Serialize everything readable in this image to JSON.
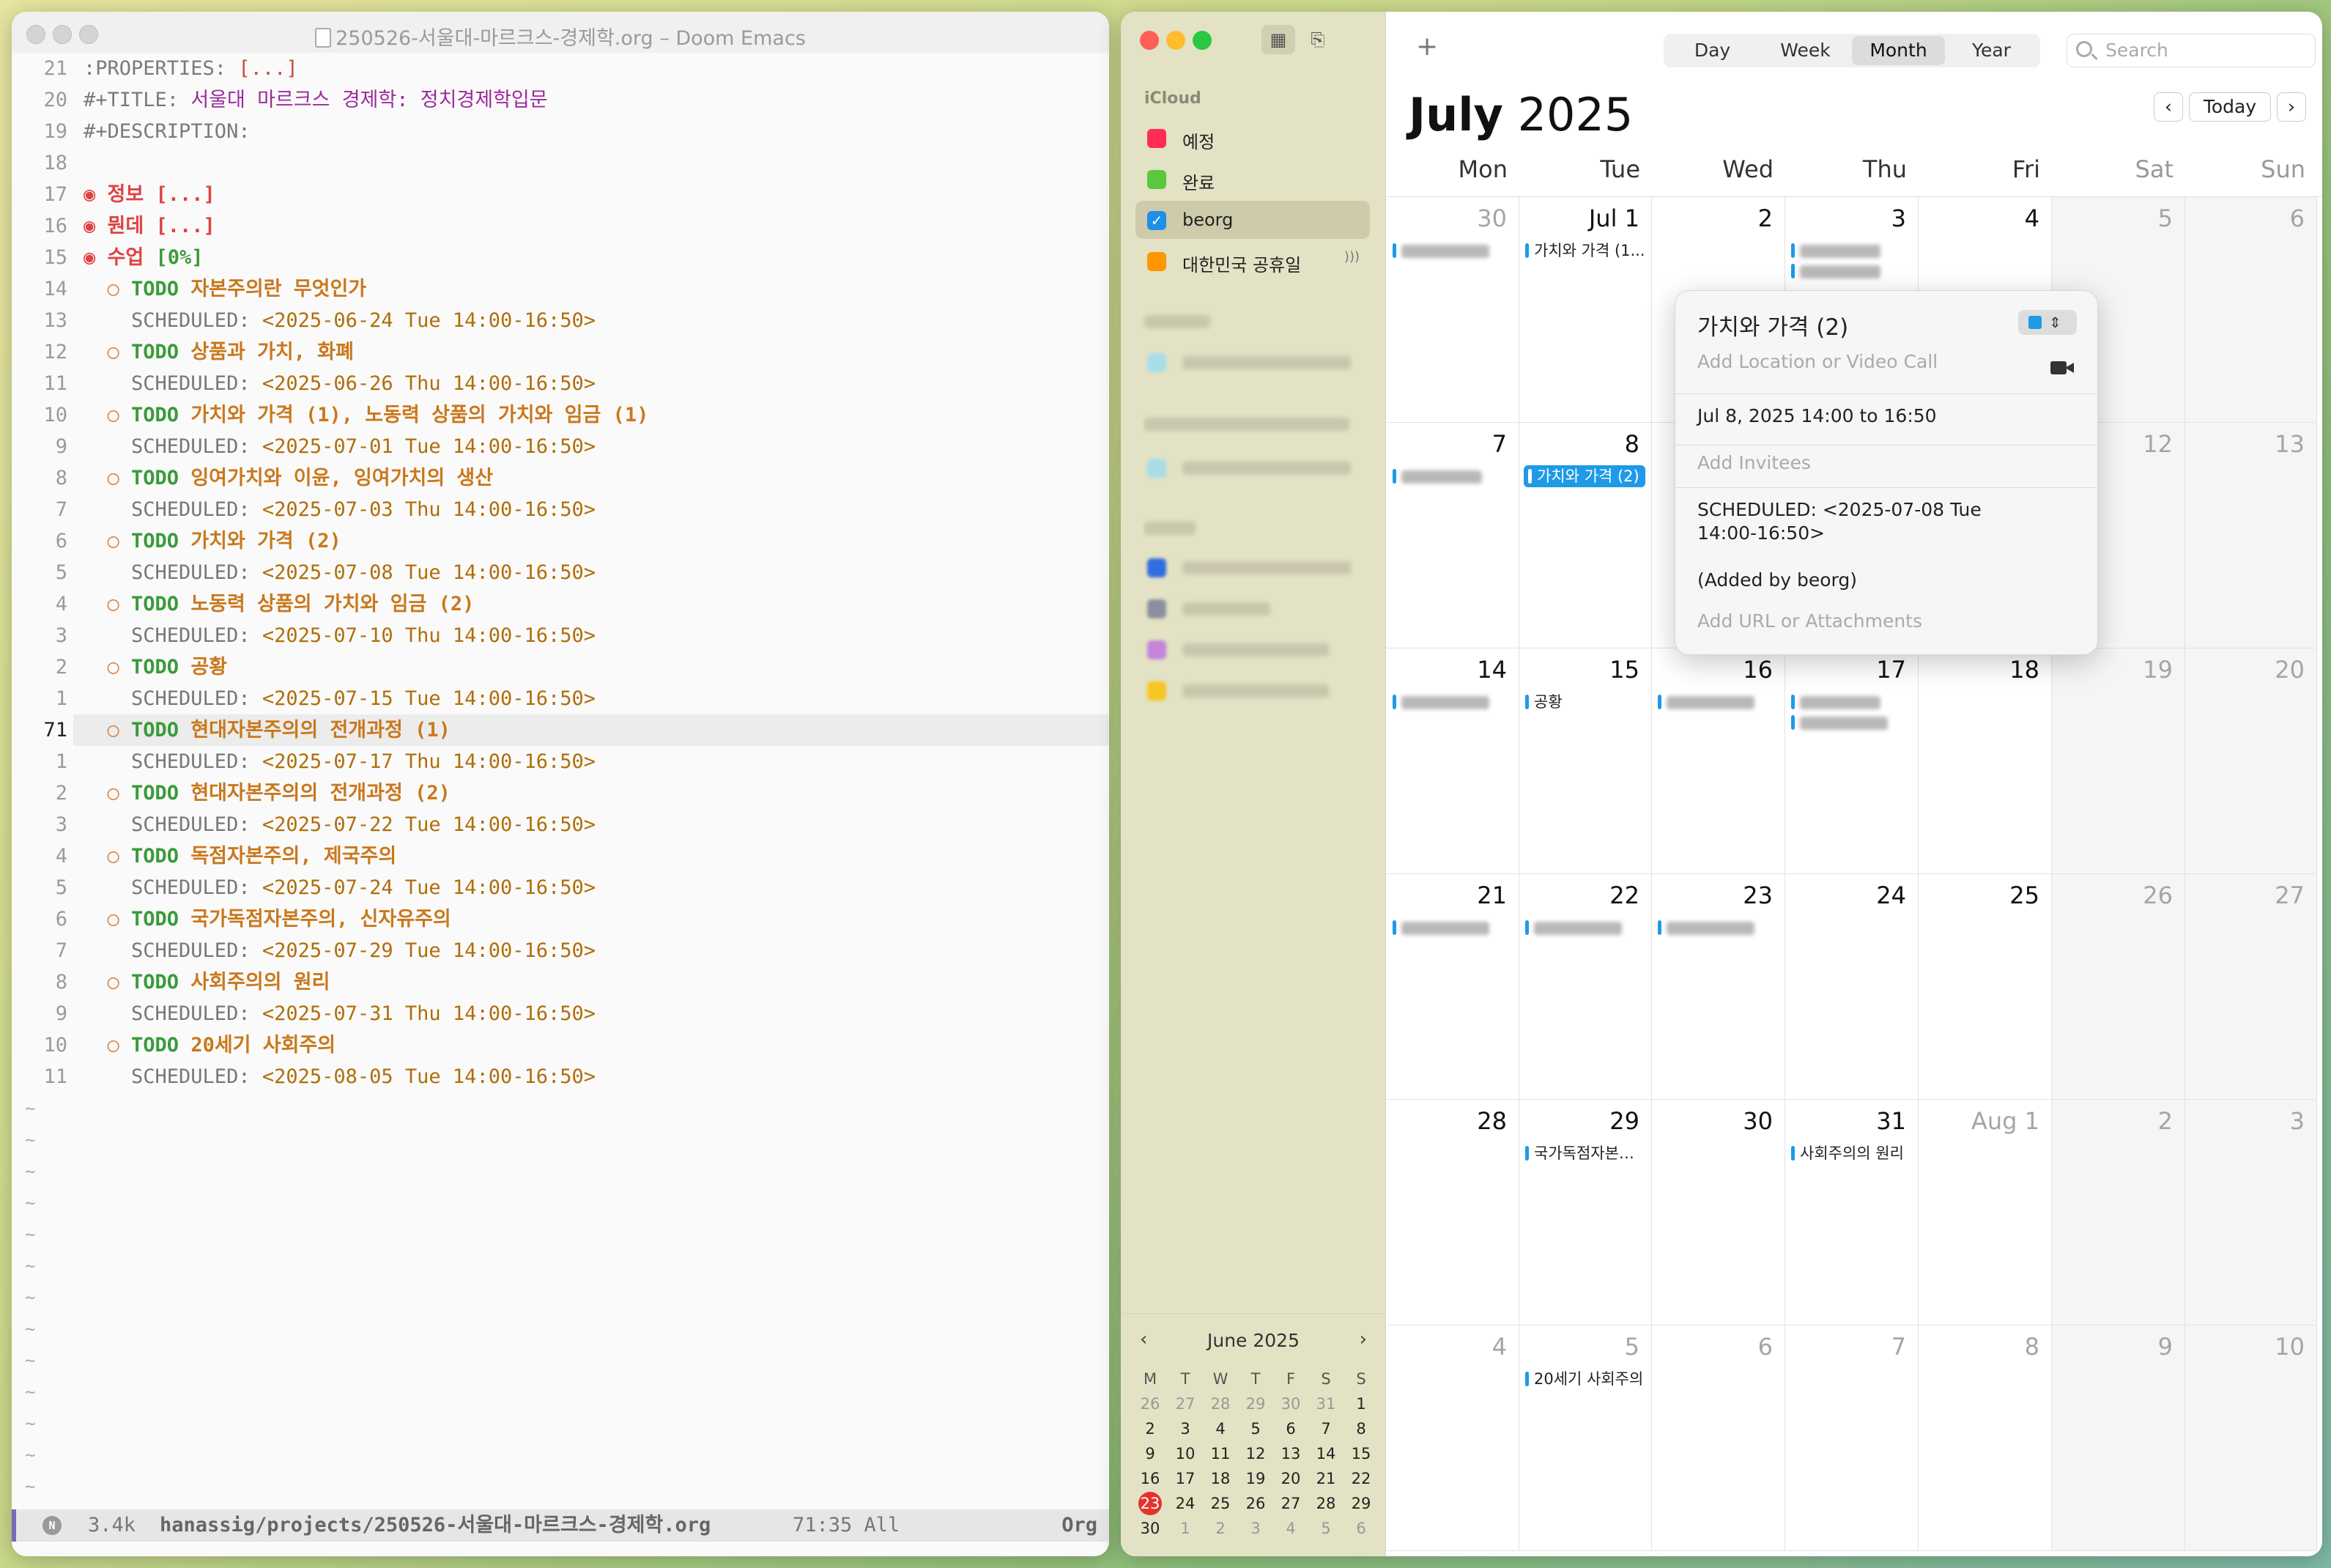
{
  "emacs": {
    "title": "250526-서울대-마르크스-경제학.org – Doom Emacs",
    "lines": [
      {
        "ln": "21",
        "type": "meta",
        "parts": [
          ":PROPERTIES: ",
          "[...]"
        ]
      },
      {
        "ln": "20",
        "type": "title",
        "parts": [
          "#+TITLE: ",
          "서울대 마르크스 경제학: 정치경제학입문"
        ]
      },
      {
        "ln": "19",
        "type": "meta",
        "parts": [
          "#+DESCRIPTION:"
        ]
      },
      {
        "ln": "18",
        "type": "blank",
        "parts": []
      },
      {
        "ln": "17",
        "type": "h1",
        "parts": [
          "◉ ",
          "정보 [...]"
        ]
      },
      {
        "ln": "16",
        "type": "h1",
        "parts": [
          "◉ ",
          "뭔데 [...]"
        ]
      },
      {
        "ln": "15",
        "type": "h1pct",
        "parts": [
          "◉ ",
          "수업 ",
          "[0%]"
        ]
      },
      {
        "ln": "14",
        "type": "todo",
        "parts": [
          "  ○ ",
          "TODO ",
          "자본주의란 무엇인가"
        ]
      },
      {
        "ln": "13",
        "type": "sched",
        "parts": [
          "    SCHEDULED: ",
          "<2025-06-24 Tue 14:00-16:50>"
        ]
      },
      {
        "ln": "12",
        "type": "todo",
        "parts": [
          "  ○ ",
          "TODO ",
          "상품과 가치, 화폐"
        ]
      },
      {
        "ln": "11",
        "type": "sched",
        "parts": [
          "    SCHEDULED: ",
          "<2025-06-26 Thu 14:00-16:50>"
        ]
      },
      {
        "ln": "10",
        "type": "todo",
        "parts": [
          "  ○ ",
          "TODO ",
          "가치와 가격 (1), 노동력 상품의 가치와 임금 (1)"
        ]
      },
      {
        "ln": "9",
        "type": "sched",
        "parts": [
          "    SCHEDULED: ",
          "<2025-07-01 Tue 14:00-16:50>"
        ]
      },
      {
        "ln": "8",
        "type": "todo",
        "parts": [
          "  ○ ",
          "TODO ",
          "잉여가치와 이윤, 잉여가치의 생산"
        ]
      },
      {
        "ln": "7",
        "type": "sched",
        "parts": [
          "    SCHEDULED: ",
          "<2025-07-03 Thu 14:00-16:50>"
        ]
      },
      {
        "ln": "6",
        "type": "todo",
        "parts": [
          "  ○ ",
          "TODO ",
          "가치와 가격 (2)"
        ]
      },
      {
        "ln": "5",
        "type": "sched",
        "parts": [
          "    SCHEDULED: ",
          "<2025-07-08 Tue 14:00-16:50>"
        ]
      },
      {
        "ln": "4",
        "type": "todo",
        "parts": [
          "  ○ ",
          "TODO ",
          "노동력 상품의 가치와 임금 (2)"
        ]
      },
      {
        "ln": "3",
        "type": "sched",
        "parts": [
          "    SCHEDULED: ",
          "<2025-07-10 Thu 14:00-16:50>"
        ]
      },
      {
        "ln": "2",
        "type": "todo",
        "parts": [
          "  ○ ",
          "TODO ",
          "공황"
        ]
      },
      {
        "ln": "1",
        "type": "sched",
        "parts": [
          "    SCHEDULED: ",
          "<2025-07-15 Tue 14:00-16:50>"
        ]
      },
      {
        "ln": "71",
        "type": "todo",
        "current": true,
        "parts": [
          "  ○ ",
          "TODO ",
          "현대자본주의의 전개과정 (1)"
        ]
      },
      {
        "ln": "1",
        "type": "sched",
        "parts": [
          "    SCHEDULED: ",
          "<2025-07-17 Thu 14:00-16:50>"
        ]
      },
      {
        "ln": "2",
        "type": "todo",
        "parts": [
          "  ○ ",
          "TODO ",
          "현대자본주의의 전개과정 (2)"
        ]
      },
      {
        "ln": "3",
        "type": "sched",
        "parts": [
          "    SCHEDULED: ",
          "<2025-07-22 Tue 14:00-16:50>"
        ]
      },
      {
        "ln": "4",
        "type": "todo",
        "parts": [
          "  ○ ",
          "TODO ",
          "독점자본주의, 제국주의"
        ]
      },
      {
        "ln": "5",
        "type": "sched",
        "parts": [
          "    SCHEDULED: ",
          "<2025-07-24 Tue 14:00-16:50>"
        ]
      },
      {
        "ln": "6",
        "type": "todo",
        "parts": [
          "  ○ ",
          "TODO ",
          "국가독점자본주의, 신자유주의"
        ]
      },
      {
        "ln": "7",
        "type": "sched",
        "parts": [
          "    SCHEDULED: ",
          "<2025-07-29 Tue 14:00-16:50>"
        ]
      },
      {
        "ln": "8",
        "type": "todo",
        "parts": [
          "  ○ ",
          "TODO ",
          "사회주의의 원리"
        ]
      },
      {
        "ln": "9",
        "type": "sched",
        "parts": [
          "    SCHEDULED: ",
          "<2025-07-31 Thu 14:00-16:50>"
        ]
      },
      {
        "ln": "10",
        "type": "todo",
        "parts": [
          "  ○ ",
          "TODO ",
          "20세기 사회주의"
        ]
      },
      {
        "ln": "11",
        "type": "sched",
        "parts": [
          "    SCHEDULED: ",
          "<2025-08-05 Tue 14:00-16:50>"
        ]
      }
    ],
    "tilde": "~",
    "modeline": {
      "icon": "N",
      "size": "3.4k",
      "path": "hanassig/projects/250526-서울대-마르크스-경제학.org",
      "position": "71:35 All",
      "mode": "Org"
    }
  },
  "calendar": {
    "sidebar": {
      "section_icloud": "iCloud",
      "calendars": [
        {
          "name": "예정",
          "color": "#ff2d55"
        },
        {
          "name": "완료",
          "color": "#5ac83c"
        },
        {
          "name": "beorg",
          "color": "#1e90e6",
          "checked": true
        },
        {
          "name": "대한민국 공휴일",
          "color": "#ff9500",
          "broadcast": true
        }
      ],
      "mini": {
        "title": "June 2025",
        "prev": "‹",
        "next": "›",
        "headers": [
          "M",
          "T",
          "W",
          "T",
          "F",
          "S",
          "S"
        ],
        "rows": [
          [
            "26",
            "27",
            "28",
            "29",
            "30",
            "31",
            "1"
          ],
          [
            "2",
            "3",
            "4",
            "5",
            "6",
            "7",
            "8"
          ],
          [
            "9",
            "10",
            "11",
            "12",
            "13",
            "14",
            "15"
          ],
          [
            "16",
            "17",
            "18",
            "19",
            "20",
            "21",
            "22"
          ],
          [
            "23",
            "24",
            "25",
            "26",
            "27",
            "28",
            "29"
          ],
          [
            "30",
            "1",
            "2",
            "3",
            "4",
            "5",
            "6"
          ]
        ],
        "today": "23"
      }
    },
    "toolbar": {
      "add": "+",
      "views": [
        "Day",
        "Week",
        "Month",
        "Year"
      ],
      "active_view": "Month",
      "search_placeholder": "Search"
    },
    "header": {
      "month": "July",
      "year": "2025",
      "today": "Today",
      "prev": "‹",
      "next": "›"
    },
    "weekdays": [
      "Mon",
      "Tue",
      "Wed",
      "Thu",
      "Fri",
      "Sat",
      "Sun"
    ],
    "weeks": [
      [
        {
          "d": "30",
          "dim": true,
          "ev": [
            {
              "blur": 120
            }
          ]
        },
        {
          "d": "Jul 1",
          "ev": [
            {
              "t": "가치와 가격 (1..."
            }
          ]
        },
        {
          "d": "2",
          "ev": []
        },
        {
          "d": "3",
          "ev": [
            {
              "blur": 110
            },
            {
              "blur": 110
            }
          ]
        },
        {
          "d": "4",
          "ev": []
        },
        {
          "d": "5",
          "ev": []
        },
        {
          "d": "6",
          "ev": []
        }
      ],
      [
        {
          "d": "7",
          "ev": [
            {
              "blur": 110
            }
          ]
        },
        {
          "d": "8",
          "ev": [
            {
              "t": "가치와 가격 (2)",
              "sel": true
            }
          ]
        },
        {
          "d": "9",
          "ev": []
        },
        {
          "d": "10",
          "ev": []
        },
        {
          "d": "11",
          "ev": []
        },
        {
          "d": "12",
          "ev": []
        },
        {
          "d": "13",
          "ev": []
        }
      ],
      [
        {
          "d": "14",
          "ev": [
            {
              "blur": 120
            }
          ]
        },
        {
          "d": "15",
          "ev": [
            {
              "t": "공황"
            }
          ]
        },
        {
          "d": "16",
          "ev": [
            {
              "blur": 120
            }
          ]
        },
        {
          "d": "17",
          "ev": [
            {
              "blur": 110
            },
            {
              "blur": 120
            }
          ]
        },
        {
          "d": "18",
          "ev": []
        },
        {
          "d": "19",
          "ev": []
        },
        {
          "d": "20",
          "ev": []
        }
      ],
      [
        {
          "d": "21",
          "ev": [
            {
              "blur": 120
            }
          ]
        },
        {
          "d": "22",
          "ev": [
            {
              "blur": 120
            }
          ]
        },
        {
          "d": "23",
          "ev": [
            {
              "blur": 120
            }
          ]
        },
        {
          "d": "24",
          "ev": []
        },
        {
          "d": "25",
          "ev": []
        },
        {
          "d": "26",
          "ev": []
        },
        {
          "d": "27",
          "ev": []
        }
      ],
      [
        {
          "d": "28",
          "ev": []
        },
        {
          "d": "29",
          "ev": [
            {
              "t": "국가독점자본…"
            }
          ]
        },
        {
          "d": "30",
          "ev": []
        },
        {
          "d": "31",
          "ev": [
            {
              "t": "사회주의의 원리"
            }
          ]
        },
        {
          "d": "Aug 1",
          "dim": true,
          "ev": []
        },
        {
          "d": "2",
          "dim": true,
          "ev": []
        },
        {
          "d": "3",
          "dim": true,
          "ev": []
        }
      ],
      [
        {
          "d": "4",
          "dim": true,
          "ev": []
        },
        {
          "d": "5",
          "dim": true,
          "ev": [
            {
              "t": "20세기 사회주의"
            }
          ]
        },
        {
          "d": "6",
          "dim": true,
          "ev": []
        },
        {
          "d": "7",
          "dim": true,
          "ev": []
        },
        {
          "d": "8",
          "dim": true,
          "ev": []
        },
        {
          "d": "9",
          "dim": true,
          "ev": []
        },
        {
          "d": "10",
          "dim": true,
          "ev": []
        }
      ]
    ],
    "popover": {
      "title": "가치와 가격 (2)",
      "location_placeholder": "Add Location or Video Call",
      "datetime": "Jul 8, 2025  14:00 to 16:50",
      "invitees_placeholder": "Add Invitees",
      "notes_line1": "SCHEDULED: <2025-07-08 Tue",
      "notes_line2": "14:00-16:50>",
      "notes_line3": "(Added by beorg)",
      "url_placeholder": "Add URL or Attachments",
      "color": "#1e9ae8"
    }
  }
}
